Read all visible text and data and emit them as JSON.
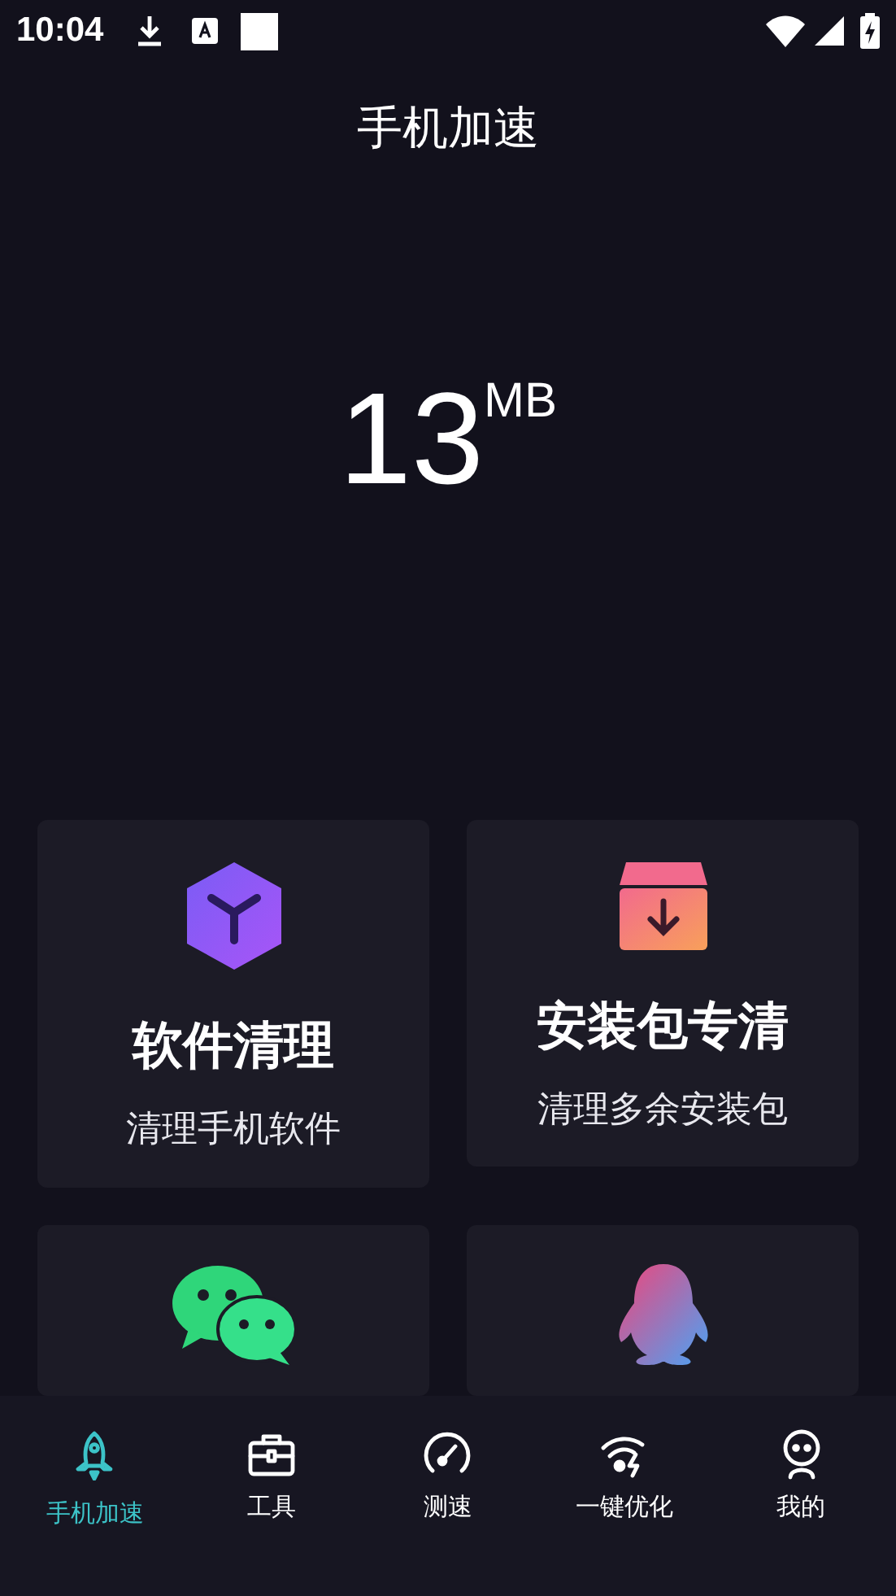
{
  "status_bar": {
    "time": "10:04"
  },
  "header": {
    "title": "手机加速"
  },
  "memory": {
    "value": "13",
    "unit": "MB"
  },
  "cards": [
    {
      "kind": "cube",
      "title": "软件清理",
      "subtitle": "清理手机软件"
    },
    {
      "kind": "package",
      "title": "安装包专清",
      "subtitle": "清理多余安装包"
    },
    {
      "kind": "chat"
    },
    {
      "kind": "penguin"
    }
  ],
  "nav": [
    {
      "kind": "rocket",
      "label": "手机加速",
      "selected": true
    },
    {
      "kind": "toolbox",
      "label": "工具",
      "selected": false
    },
    {
      "kind": "gauge",
      "label": "测速",
      "selected": false
    },
    {
      "kind": "wifi",
      "label": "一键优化",
      "selected": false
    },
    {
      "kind": "person",
      "label": "我的",
      "selected": false
    }
  ]
}
